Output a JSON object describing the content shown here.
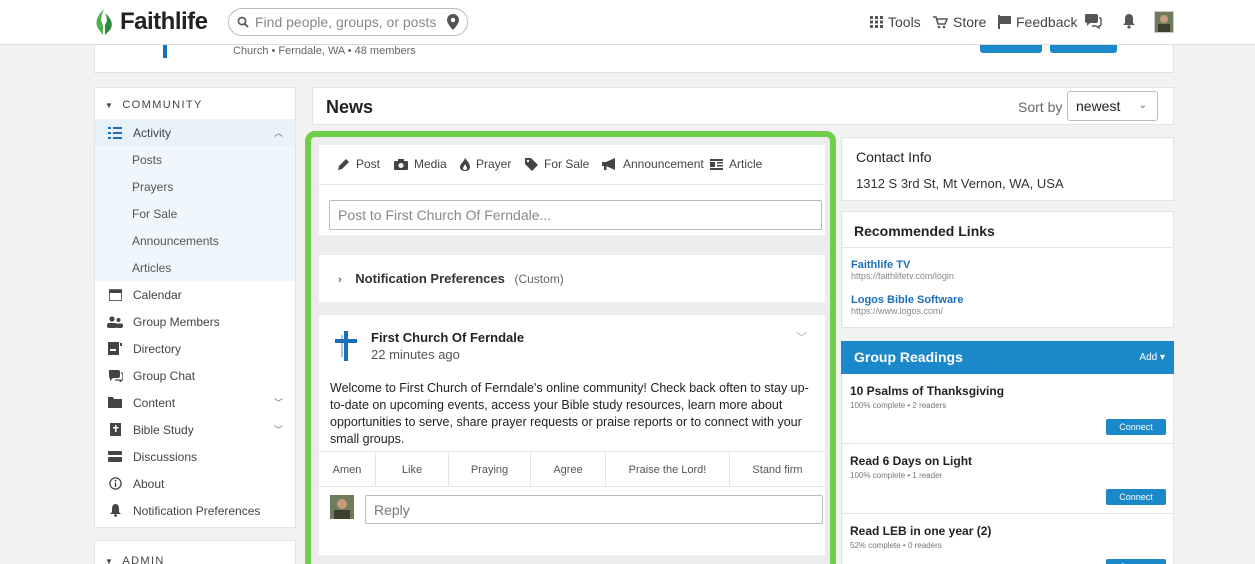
{
  "topnav": {
    "brand": "Faithlife",
    "search_placeholder": "Find people, groups, or posts",
    "tools": "Tools",
    "store": "Store",
    "feedback": "Feedback"
  },
  "group": {
    "meta": "Church • Ferndale, WA • 48 members"
  },
  "sidebar": {
    "community_heading": "COMMUNITY",
    "admin_heading": "ADMIN",
    "activity": "Activity",
    "activity_sub": [
      "Posts",
      "Prayers",
      "For Sale",
      "Announcements",
      "Articles"
    ],
    "items": [
      "Calendar",
      "Group Members",
      "Directory",
      "Group Chat",
      "Content",
      "Bible Study",
      "Discussions",
      "About",
      "Notification Preferences"
    ]
  },
  "news": {
    "title": "News",
    "sort_label": "Sort by",
    "sort_value": "newest"
  },
  "composer": {
    "types": [
      "Post",
      "Media",
      "Prayer",
      "For Sale",
      "Announcement",
      "Article"
    ],
    "placeholder": "Post to First Church Of Ferndale..."
  },
  "notification": {
    "label": "Notification Preferences",
    "value": "(Custom)"
  },
  "post": {
    "author": "First Church Of Ferndale",
    "time": "22 minutes ago",
    "body": "Welcome to First Church of Ferndale's online community! Check back often to stay up-to-date on upcoming events, access your Bible study resources, learn more about opportunities to serve, share prayer requests or praise reports or to connect with your small groups.",
    "reactions": [
      "Amen",
      "Like",
      "Praying",
      "Agree",
      "Praise the Lord!",
      "Stand firm"
    ],
    "reply_placeholder": "Reply"
  },
  "contact": {
    "heading": "Contact Info",
    "address": "1312 S 3rd St, Mt Vernon, WA, USA"
  },
  "links": {
    "heading": "Recommended Links",
    "items": [
      {
        "name": "Faithlife TV",
        "url": "https://faithlifetv.com/login"
      },
      {
        "name": "Logos Bible Software",
        "url": "https://www.logos.com/"
      }
    ]
  },
  "readings": {
    "heading": "Group Readings",
    "add_label": "Add ▾",
    "connect_label": "Connect",
    "items": [
      {
        "title": "10 Psalms of Thanksgiving",
        "meta": "100% complete • 2 readers"
      },
      {
        "title": "Read 6 Days on Light",
        "meta": "100% complete • 1 reader"
      },
      {
        "title": "Read LEB in one year (2)",
        "meta": "52% complete • 0 readers"
      }
    ]
  },
  "colors": {
    "accent": "#1b89c9",
    "highlight": "#6fcf4a",
    "brand_leaf": "#4caf50"
  }
}
